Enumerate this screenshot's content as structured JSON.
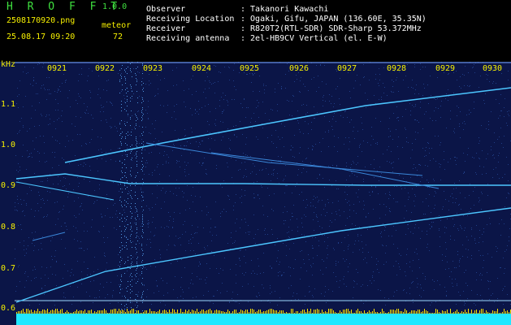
{
  "app": {
    "name": "H R O F F T",
    "version": "1.0.0"
  },
  "file": {
    "name": "2508170920.png",
    "datetime": "25.08.17 09:20"
  },
  "meteor": {
    "label": "meteor",
    "count": "72"
  },
  "info": {
    "observer_label": "Observer",
    "observer_value": ": Takanori Kawachi",
    "location_label": "Receiving Location",
    "location_value": ": Ogaki, Gifu, JAPAN (136.60E, 35.35N)",
    "receiver_label": "Receiver",
    "receiver_value": ": R820T2(RTL-SDR) SDR-Sharp 53.372MHz",
    "antenna_label": "Receiving antenna",
    "antenna_value": ": 2el-HB9CV Vertical (el. E-W)"
  },
  "axis": {
    "y_unit": "kHz",
    "x_ticks": [
      "0921",
      "0922",
      "0923",
      "0924",
      "0925",
      "0926",
      "0927",
      "0928",
      "0929",
      "0930"
    ],
    "y_ticks": [
      "1.1",
      "1.0",
      "0.9",
      "0.8",
      "0.7",
      "0.6"
    ]
  },
  "colors": {
    "background": "#0b1547",
    "header_text": "#f6f000",
    "title_green": "#3fe03f",
    "trace": "#4cc6ff",
    "noise_bar": "#20e8ff",
    "spike": "#ffe000"
  }
}
